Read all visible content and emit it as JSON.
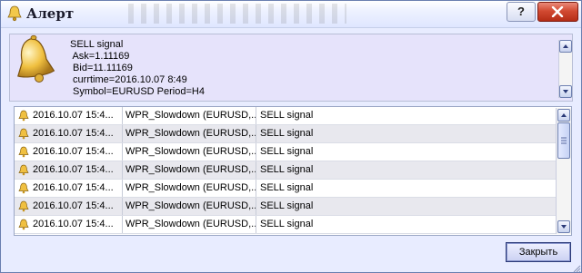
{
  "window": {
    "title": "Алерт"
  },
  "controls": {
    "help_label": "?"
  },
  "message": {
    "lines": [
      "SELL signal",
      " Ask=1.11169",
      " Bid=11.11169",
      " currtime=2016.10.07 8:49",
      " Symbol=EURUSD Period=H4"
    ]
  },
  "alerts": [
    {
      "time": "2016.10.07 15:4...",
      "expert": "WPR_Slowdown (EURUSD,...",
      "message": "SELL signal"
    },
    {
      "time": "2016.10.07 15:4...",
      "expert": "WPR_Slowdown (EURUSD,...",
      "message": "SELL signal"
    },
    {
      "time": "2016.10.07 15:4...",
      "expert": "WPR_Slowdown (EURUSD,...",
      "message": "SELL signal"
    },
    {
      "time": "2016.10.07 15:4...",
      "expert": "WPR_Slowdown (EURUSD,...",
      "message": "SELL signal"
    },
    {
      "time": "2016.10.07 15:4...",
      "expert": "WPR_Slowdown (EURUSD,...",
      "message": "SELL signal"
    },
    {
      "time": "2016.10.07 15:4...",
      "expert": "WPR_Slowdown (EURUSD,...",
      "message": "SELL signal"
    },
    {
      "time": "2016.10.07 15:4...",
      "expert": "WPR_Slowdown (EURUSD,...",
      "message": "SELL signal"
    }
  ],
  "footer": {
    "close_button_label": "Закрыть"
  },
  "icons": {
    "title": "bell-icon",
    "message": "bell-icon",
    "row": "bell-icon",
    "close": "close-icon"
  },
  "colors": {
    "dialog_background": "#e8ecff",
    "message_panel": "#e6e3fb",
    "close_button": "#d24a32",
    "row_alt": "#e8e8ee",
    "bell": "#f0c040"
  }
}
